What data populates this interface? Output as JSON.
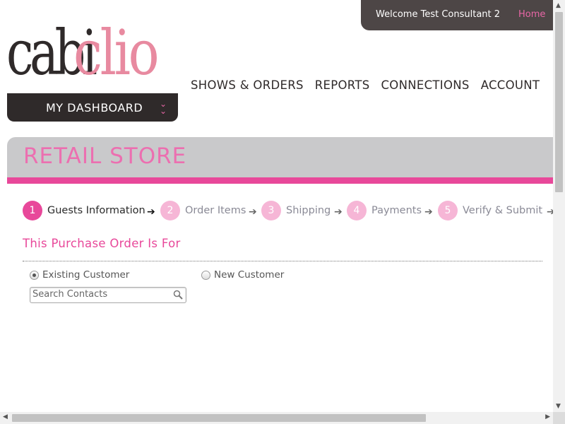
{
  "header": {
    "welcome_text": "Welcome Test Consultant 2",
    "home_link": "Home",
    "logo_part1": "cabi",
    "logo_part2": "clio",
    "dashboard_label": "MY DASHBOARD",
    "dashboard_icon": "double-chevron-down-icon"
  },
  "nav": {
    "items": [
      "SHOWS & ORDERS",
      "REPORTS",
      "CONNECTIONS",
      "ACCOUNT"
    ]
  },
  "page": {
    "title": "RETAIL STORE"
  },
  "steps": [
    {
      "number": "1",
      "label": "Guests Information",
      "active": true
    },
    {
      "number": "2",
      "label": "Order Items",
      "active": false
    },
    {
      "number": "3",
      "label": "Shipping",
      "active": false
    },
    {
      "number": "4",
      "label": "Payments",
      "active": false
    },
    {
      "number": "5",
      "label": "Verify & Submit",
      "active": false
    }
  ],
  "form": {
    "section_title": "This Purchase Order Is For",
    "radio_existing": "Existing Customer",
    "radio_new": "New Customer",
    "selected": "Existing Customer",
    "search_placeholder": "Search Contacts",
    "search_value": ""
  },
  "colors": {
    "accent_pink": "#e8489a",
    "light_pink": "#f6b6d6",
    "dark": "#2f2a2a",
    "header_gray": "#c9c9cb"
  }
}
